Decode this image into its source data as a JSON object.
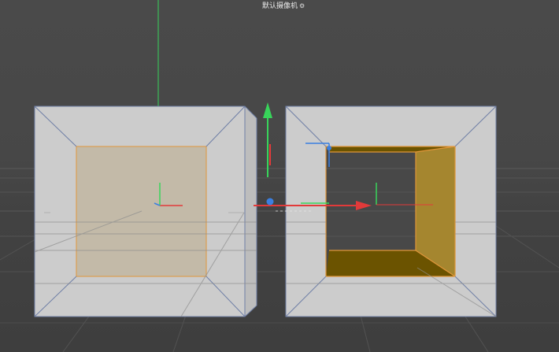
{
  "viewport": {
    "camera_label": "默认摄像机",
    "camera_icon": "camera-settings-icon",
    "colors": {
      "background": "#484848",
      "grid": "#5a5a5a",
      "object_face": "#c9c9c9",
      "object_edge": "#6f7fa6",
      "selection_edge": "#e0963a",
      "selected_polygon_fill": "#a5862f",
      "selected_polygon_dark": "#6b5300",
      "axis_x": "#e23a3a",
      "axis_y": "#38d45a",
      "axis_z": "#3b7fe0"
    }
  }
}
